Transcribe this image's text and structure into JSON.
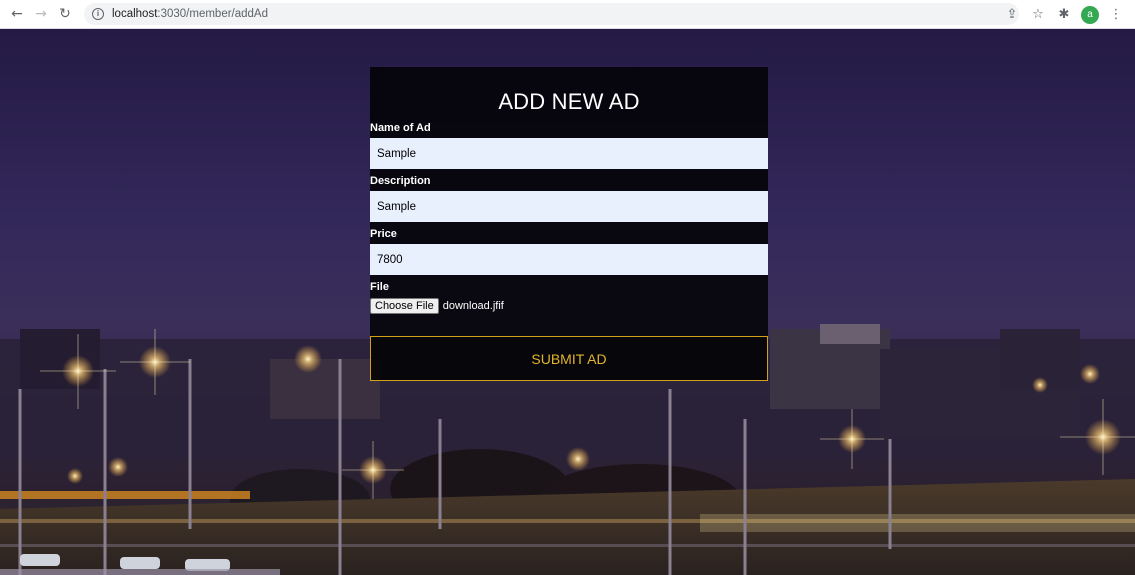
{
  "browser": {
    "url_host": "localhost",
    "url_port": ":3030",
    "url_path": "/member/addAd",
    "avatar_letter": "a"
  },
  "form": {
    "title": "ADD NEW AD",
    "name_label": "Name of Ad",
    "name_value": "Sample",
    "description_label": "Description",
    "description_value": "Sample",
    "price_label": "Price",
    "price_value": "7800",
    "file_label": "File",
    "file_button": "Choose File",
    "file_name": "download.jfif",
    "submit_label": "SUBMIT AD"
  },
  "colors": {
    "panel_bg": "#000000",
    "input_bg": "#e8f0fe",
    "submit_accent": "#d4a017"
  }
}
